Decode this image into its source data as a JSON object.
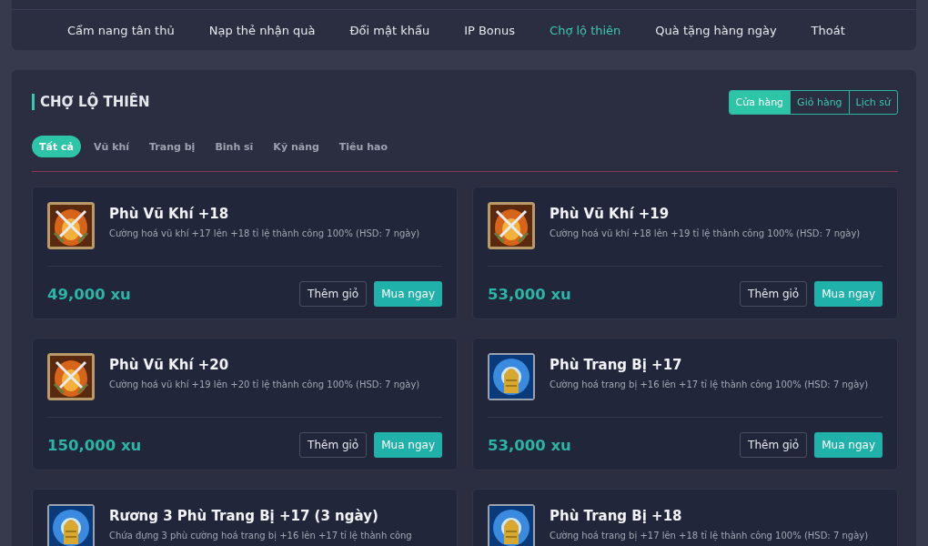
{
  "nav": [
    {
      "label": "Cẩm nang tân thủ",
      "selected": false
    },
    {
      "label": "Nạp thẻ nhận quà",
      "selected": false
    },
    {
      "label": "Đổi mật khẩu",
      "selected": false
    },
    {
      "label": "IP Bonus",
      "selected": false
    },
    {
      "label": "Chợ lộ thiên",
      "selected": true
    },
    {
      "label": "Quà tặng hàng ngày",
      "selected": false
    },
    {
      "label": "Thoát",
      "selected": false
    }
  ],
  "section_title": "CHỢ LỘ THIÊN",
  "view_tabs": [
    {
      "label": "Cửa hàng",
      "selected": true
    },
    {
      "label": "Giỏ hàng",
      "selected": false
    },
    {
      "label": "Lịch sử",
      "selected": false
    }
  ],
  "categories": [
    {
      "label": "Tất cả",
      "selected": true
    },
    {
      "label": "Vũ khí",
      "selected": false
    },
    {
      "label": "Trang bị",
      "selected": false
    },
    {
      "label": "Binh sĩ",
      "selected": false
    },
    {
      "label": "Kỹ năng",
      "selected": false
    },
    {
      "label": "Tiêu hao",
      "selected": false
    }
  ],
  "items": [
    {
      "kind": "weapon",
      "name": "Phù Vũ Khí +18",
      "description": "Cường hoá vũ khí +17 lên +18 tỉ lệ thành công 100% (HSD: 7 ngày)",
      "price": "49,000 xu",
      "add_button": "Thêm giỏ",
      "buy_button": "Mua ngay"
    },
    {
      "kind": "weapon",
      "name": "Phù Vũ Khí +19",
      "description": "Cường hoá vũ khí +18 lên +19 tỉ lệ thành công 100% (HSD: 7 ngày)",
      "price": "53,000 xu",
      "add_button": "Thêm giỏ",
      "buy_button": "Mua ngay"
    },
    {
      "kind": "weapon",
      "name": "Phù Vũ Khí +20",
      "description": "Cường hoá vũ khí +19 lên +20 tỉ lệ thành công 100% (HSD: 7 ngày)",
      "price": "150,000 xu",
      "add_button": "Thêm giỏ",
      "buy_button": "Mua ngay"
    },
    {
      "kind": "armor",
      "name": "Phù Trang Bị +17",
      "description": "Cường hoá trang bị +16 lên +17 tỉ lệ thành công 100% (HSD: 7 ngày)",
      "price": "53,000 xu",
      "add_button": "Thêm giỏ",
      "buy_button": "Mua ngay"
    },
    {
      "kind": "armor",
      "name": "Rương 3 Phù Trang Bị +17 (3 ngày)",
      "description": "Chứa đựng 3 phù cường hoá trang bị +16 lên +17 tỉ lệ thành công"
    },
    {
      "kind": "armor",
      "name": "Phù Trang Bị +18",
      "description": "Cường hoá trang bị +17 lên +18 tỉ lệ thành công 100% (HSD: 7 ngày)"
    }
  ]
}
